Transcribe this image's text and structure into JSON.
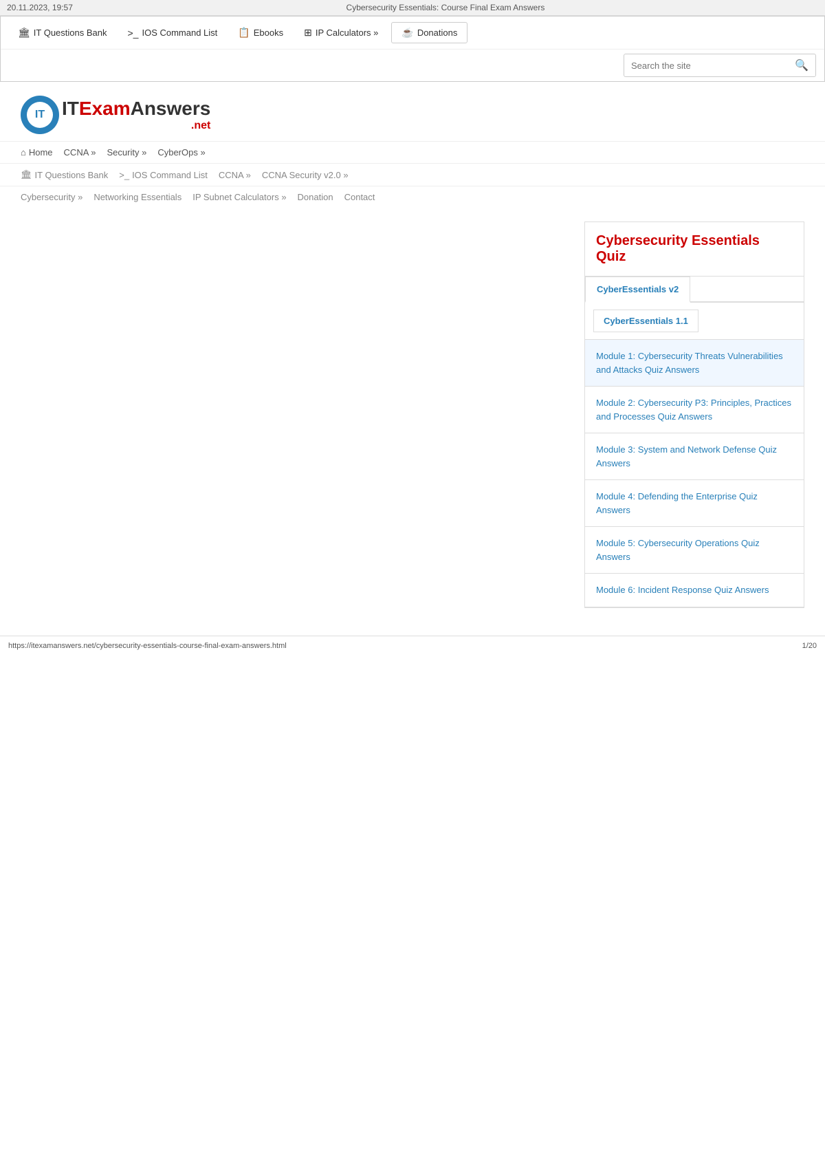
{
  "browser": {
    "timestamp": "20.11.2023, 19:57",
    "title": "Cybersecurity Essentials: Course Final Exam Answers",
    "url": "https://itexamanswers.net/cybersecurity-essentials-course-final-exam-answers.html",
    "page": "1/20"
  },
  "topnav": {
    "items": [
      {
        "label": "IT Questions Bank",
        "icon": "🏛"
      },
      {
        "label": "IOS Command List",
        "icon": ">_"
      },
      {
        "label": "Ebooks",
        "icon": "📋"
      },
      {
        "label": "IP Calculators »",
        "icon": "⊞"
      },
      {
        "label": "Donations",
        "icon": "☕"
      }
    ],
    "search_placeholder": "Search the site"
  },
  "logo": {
    "it_text": "IT",
    "exam_text": "Exam",
    "answers_text": "Answers",
    "net_text": ".net"
  },
  "mainnav": {
    "row1": [
      {
        "label": "Home",
        "icon": "⌂",
        "has_arrow": false
      },
      {
        "label": "CCNA »",
        "has_arrow": false
      },
      {
        "label": "Security »",
        "has_arrow": false
      },
      {
        "label": "CyberOps »",
        "has_arrow": false
      }
    ],
    "row2": [
      {
        "label": "IT Questions Bank",
        "icon": "🏛",
        "has_arrow": false
      },
      {
        "label": "IOS Command List",
        "icon": ">_",
        "has_arrow": false
      },
      {
        "label": "CCNA »",
        "has_arrow": false
      },
      {
        "label": "CCNA Security v2.0 »",
        "has_arrow": false
      }
    ],
    "row3": [
      {
        "label": "Cybersecurity »",
        "has_arrow": false
      },
      {
        "label": "Networking Essentials",
        "has_arrow": false
      },
      {
        "label": "IP Subnet Calculators »",
        "has_arrow": false
      },
      {
        "label": "Donation",
        "has_arrow": false
      },
      {
        "label": "Contact",
        "has_arrow": false
      }
    ]
  },
  "sidebar": {
    "quiz_title": "Cybersecurity Essentials Quiz",
    "tabs": [
      {
        "label": "CyberEssentials v2",
        "active": true
      },
      {
        "label": "CyberEssentials 1.1",
        "active": false
      }
    ],
    "subtab": "CyberEssentials 1.1",
    "modules": [
      {
        "label": "Module 1: Cybersecurity Threats Vulnerabilities and Attacks Quiz Answers",
        "active": true
      },
      {
        "label": "Module 2: Cybersecurity P3: Principles, Practices and Processes Quiz Answers"
      },
      {
        "label": "Module 3: System and Network Defense Quiz Answers"
      },
      {
        "label": "Module 4: Defending the Enterprise Quiz Answers"
      },
      {
        "label": "Module 5: Cybersecurity Operations Quiz Answers"
      },
      {
        "label": "Module 6: Incident Response Quiz Answers"
      }
    ]
  },
  "footer": {
    "url": "https://itexamanswers.net/cybersecurity-essentials-course-final-exam-answers.html",
    "page": "1/20"
  }
}
